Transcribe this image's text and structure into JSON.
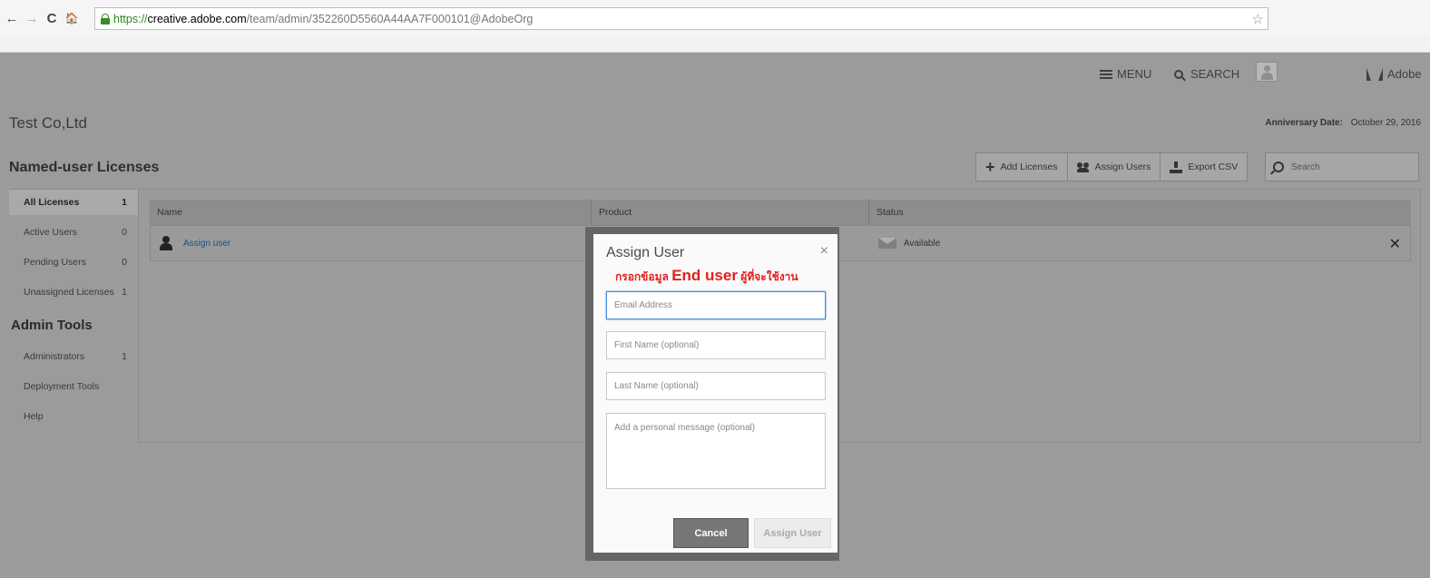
{
  "browser": {
    "url_scheme": "https://",
    "url_host": "creative.adobe.com",
    "url_path": "/team/admin/352260D5560A44AA7F000101@AdobeOrg",
    "back": "←",
    "forward": "→",
    "reload": "C",
    "home": "🏠",
    "star": "☆"
  },
  "topbar": {
    "menu_label": "MENU",
    "search_label": "SEARCH",
    "brand": "Adobe"
  },
  "org": {
    "name": "Test Co,Ltd",
    "anniversary_label": "Anniversary Date:",
    "anniversary_value": "October 29, 2016"
  },
  "section_title": "Named-user Licenses",
  "toolbar": {
    "add_licenses": "Add Licenses",
    "assign_users": "Assign Users",
    "export_csv": "Export CSV",
    "search_placeholder": "Search"
  },
  "sidebar": {
    "items": [
      {
        "label": "All Licenses",
        "count": "1"
      },
      {
        "label": "Active Users",
        "count": "0"
      },
      {
        "label": "Pending Users",
        "count": "0"
      },
      {
        "label": "Unassigned Licenses",
        "count": "1"
      }
    ],
    "admin_heading": "Admin Tools",
    "admin_items": [
      {
        "label": "Administrators",
        "count": "1"
      },
      {
        "label": "Deployment Tools",
        "count": ""
      },
      {
        "label": "Help",
        "count": ""
      }
    ]
  },
  "table": {
    "headers": [
      "Name",
      "Product",
      "Status"
    ],
    "rows": [
      {
        "name": "Assign user",
        "product": "",
        "status": "Available"
      }
    ],
    "row_close": "✕"
  },
  "dialog": {
    "title": "Assign User",
    "close": "×",
    "annotation_prefix": "กรอกข้อมูล",
    "annotation_big": "End user",
    "annotation_suffix": "ผู้ที่จะใช้งาน",
    "email_placeholder": "Email Address",
    "first_name_placeholder": "First Name (optional)",
    "last_name_placeholder": "Last Name (optional)",
    "message_placeholder": "Add a personal message (optional)",
    "cancel_label": "Cancel",
    "assign_label": "Assign User"
  }
}
